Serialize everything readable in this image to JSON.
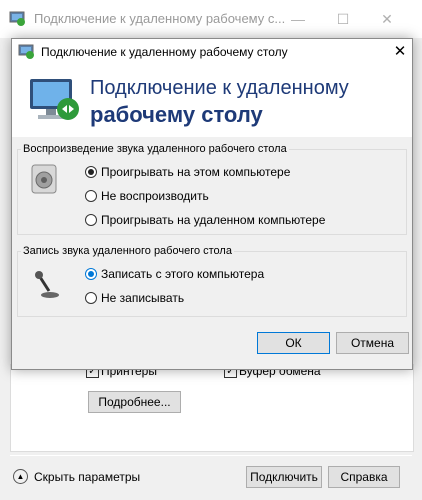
{
  "background": {
    "title": "Подключение к удаленному рабочему с...",
    "checkbox_printers": "Принтеры",
    "checkbox_clipboard": "Буфер обмена",
    "more_button": "Подробнее...",
    "hide_options": "Скрыть параметры",
    "connect_button": "Подключить",
    "help_button": "Справка"
  },
  "dialog": {
    "title": "Подключение к удаленному рабочему столу",
    "heading_line1": "Подключение к удаленному",
    "heading_line2": "рабочему столу",
    "playback_group": {
      "legend": "Воспроизведение звука удаленного рабочего стола",
      "options": [
        {
          "label": "Проигрывать на этом компьютере",
          "selected": true
        },
        {
          "label": "Не воспроизводить",
          "selected": false
        },
        {
          "label": "Проигрывать на удаленном компьютере",
          "selected": false
        }
      ]
    },
    "record_group": {
      "legend": "Запись звука удаленного рабочего стола",
      "options": [
        {
          "label": "Записать с этого компьютера",
          "selected": true
        },
        {
          "label": "Не записывать",
          "selected": false
        }
      ]
    },
    "ok_button": "ОК",
    "cancel_button": "Отмена"
  },
  "colors": {
    "accent": "#0078d7",
    "heading": "#1e3a78",
    "desktop": "#1166c4"
  }
}
